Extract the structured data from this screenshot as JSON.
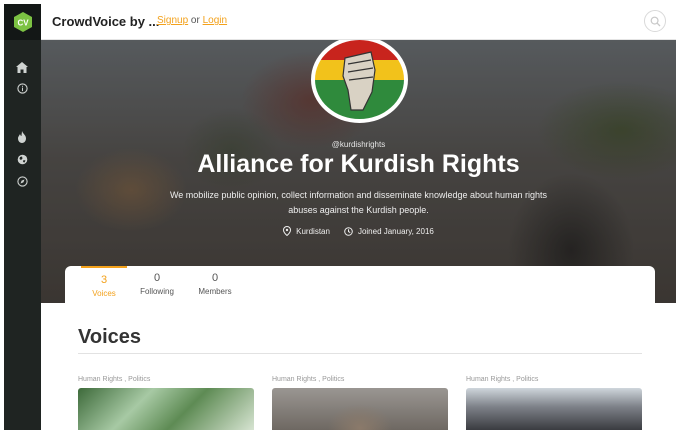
{
  "header": {
    "logo_text": "CV",
    "brand": "CrowdVoice by ...",
    "signup": "Signup",
    "or": "or",
    "login": "Login"
  },
  "profile": {
    "handle": "@kurdishrights",
    "name": "Alliance for Kurdish Rights",
    "description": "We mobilize public opinion, collect information and disseminate knowledge about human rights abuses against the Kurdish people.",
    "location": "Kurdistan",
    "joined": "Joined January, 2016"
  },
  "stats": [
    {
      "value": "3",
      "label": "Voices",
      "active": true
    },
    {
      "value": "0",
      "label": "Following",
      "active": false
    },
    {
      "value": "0",
      "label": "Members",
      "active": false
    }
  ],
  "section_title": "Voices",
  "voices": [
    {
      "categories": "Human Rights ,  Politics"
    },
    {
      "categories": "Human Rights ,  Politics"
    },
    {
      "categories": "Human Rights ,  Politics"
    }
  ],
  "colors": {
    "accent": "#f3a11b",
    "sidebar": "#1f2422",
    "logo_hex": "#7cc243"
  },
  "icons": {
    "sidebar": [
      "home-icon",
      "info-icon",
      "fire-icon",
      "globe-icon",
      "compass-icon"
    ],
    "topbar": [
      "search-icon"
    ],
    "meta": [
      "location-pin-icon",
      "clock-icon"
    ]
  }
}
